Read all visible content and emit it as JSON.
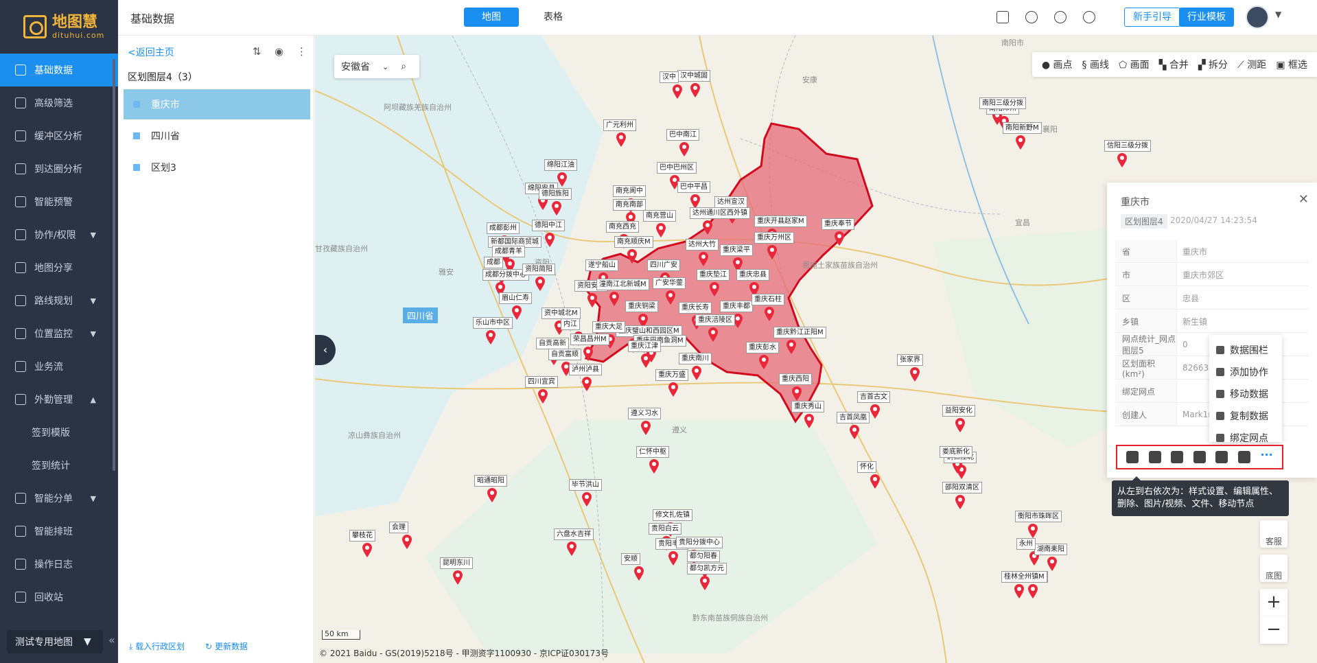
{
  "app": {
    "logo_name": "地图慧",
    "logo_sub": "dituhui.com",
    "page_title": "基础数据"
  },
  "nav": {
    "items": [
      {
        "label": "基础数据",
        "icon": "table-icon",
        "active": true
      },
      {
        "label": "高级筛选",
        "icon": "filter-icon"
      },
      {
        "label": "缓冲区分析",
        "icon": "target-icon"
      },
      {
        "label": "到达圈分析",
        "icon": "clock-icon"
      },
      {
        "label": "智能预警",
        "icon": "alert-icon"
      },
      {
        "label": "协作/权限",
        "icon": "user-icon",
        "expand": true
      },
      {
        "label": "地图分享",
        "icon": "share-icon"
      },
      {
        "label": "路线规划",
        "icon": "route-icon",
        "expand": true
      },
      {
        "label": "位置监控",
        "icon": "location-icon",
        "expand": true
      },
      {
        "label": "业务流",
        "icon": "flow-icon"
      },
      {
        "label": "外勤管理",
        "icon": "field-icon",
        "expanded": true
      }
    ],
    "sub_items": [
      "签到模版",
      "签到统计"
    ],
    "items2": [
      {
        "label": "智能分单",
        "icon": "dispatch-icon",
        "expand": true
      },
      {
        "label": "智能排班",
        "icon": "calendar-icon"
      },
      {
        "label": "操作日志",
        "icon": "log-icon"
      },
      {
        "label": "回收站",
        "icon": "trash-icon"
      }
    ],
    "footer_map": "测试专用地图"
  },
  "topbar": {
    "tab_map": "地图",
    "tab_table": "表格",
    "btn_guide": "新手引导",
    "btn_template": "行业模板"
  },
  "panel": {
    "back": "<返回主页",
    "layer_header": "区划图层4（3）",
    "layers": [
      "重庆市",
      "四川省",
      "区划3"
    ],
    "load_admin": "载入行政区划",
    "update_data": "更新数据"
  },
  "map": {
    "province_select": "安徽省",
    "toolbar": [
      "画点",
      "画线",
      "画面",
      "合并",
      "拆分",
      "测距",
      "框选"
    ],
    "sichuan_tag": "四川省",
    "scale": "50 km",
    "copyright": "© 2021 Baidu - GS(2019)5218号 - 甲测资字1100930 - 京ICP证030173号",
    "region_names": [
      "阿坝藏族羌族自治州",
      "甘孜藏族自治州",
      "凉山彝族自治州",
      "恩施土家族苗族自治州",
      "黔东南苗族侗族自治州",
      "南阳市",
      "安康",
      "宜昌",
      "襄阳",
      "遵义",
      "雅安",
      "资阳"
    ],
    "labels": [
      "汉中城固",
      "汉中",
      "广元利州",
      "巴中南江",
      "巴中巴州区",
      "巴中平昌",
      "达州宣汉",
      "达州通川区西外镇",
      "绵阳江油",
      "绵阳安县",
      "德阳旌阳",
      "德阳中江",
      "成都彭州",
      "新都国际商贸城",
      "成都青羊",
      "成都",
      "成都分拨中心",
      "资阳简阳",
      "眉山仁寿",
      "乐山市中区",
      "资中城北M",
      "内江",
      "自贡高新",
      "自贡富顺",
      "泸州泸县",
      "四川宜宾",
      "遂宁船山",
      "资阳安岳",
      "潼南江北新城M",
      "南充阆中",
      "南充南部",
      "南充营山",
      "南充西充",
      "南充顺庆M",
      "四川广安",
      "广安华蓥",
      "达州大竹",
      "重庆梁平",
      "重庆垫江",
      "重庆忠县",
      "重庆万州区",
      "重庆开县赵家M",
      "重庆奉节",
      "重庆长寿",
      "重庆丰都",
      "重庆石柱",
      "重庆涪陵区",
      "重庆铜梁",
      "重庆璧山和西园区M",
      "重庆巴南鱼洞M",
      "重庆大足",
      "荣昌昌州M",
      "重庆江津",
      "重庆南川",
      "重庆万盛",
      "重庆彭水",
      "重庆黔江正阳M",
      "重庆西阳",
      "重庆秀山",
      "遵义习水",
      "仁怀中枢",
      "毕节洪山",
      "昭通昭阳",
      "会理",
      "攀枝花",
      "六盘水吉祥",
      "贵阳白云",
      "贵阳丰驰",
      "贵阳分拨中心",
      "修文扎佐镇",
      "安顺",
      "都匀阳春",
      "都匀凯方元",
      "昆明东川",
      "铜仁江北",
      "怀化",
      "吉首古文",
      "吉首凤凰",
      "张家界",
      "益阳安化",
      "娄底新化",
      "邵阳双清区",
      "衡阳市珠晖区",
      "湖南耒阳",
      "永州",
      "永州新田",
      "桂林全州镇M",
      "南阳新野M",
      "信阳三级分拨",
      "南阳邓州",
      "南阳三级分拨"
    ]
  },
  "info": {
    "title": "重庆市",
    "tag": "区划图层4",
    "time": "2020/04/27 14:23:54",
    "rows": [
      {
        "k": "省",
        "v": "重庆市"
      },
      {
        "k": "市",
        "v": "重庆市郊区"
      },
      {
        "k": "区",
        "v": "忠县"
      },
      {
        "k": "乡镇",
        "v": "新生镇"
      },
      {
        "k": "网点统计_网点图层5",
        "v": "0"
      },
      {
        "k": "区划面积(km²)",
        "v": "82663.1"
      },
      {
        "k": "绑定网点",
        "v": ""
      },
      {
        "k": "创建人",
        "v": "Mark1n"
      }
    ],
    "menu": [
      "数据围栏",
      "添加协作",
      "移动数据",
      "复制数据",
      "绑定网点"
    ],
    "tooltip": "从左到右依次为：样式设置、编辑属性、删除、图片/视频、文件、移动节点",
    "right_tools": [
      "客服",
      "底图"
    ]
  },
  "colors": {
    "accent": "#1b8ff0",
    "region_fill": "#e56b78",
    "region_border": "#d20a1e",
    "sidebar": "#2b3444"
  }
}
